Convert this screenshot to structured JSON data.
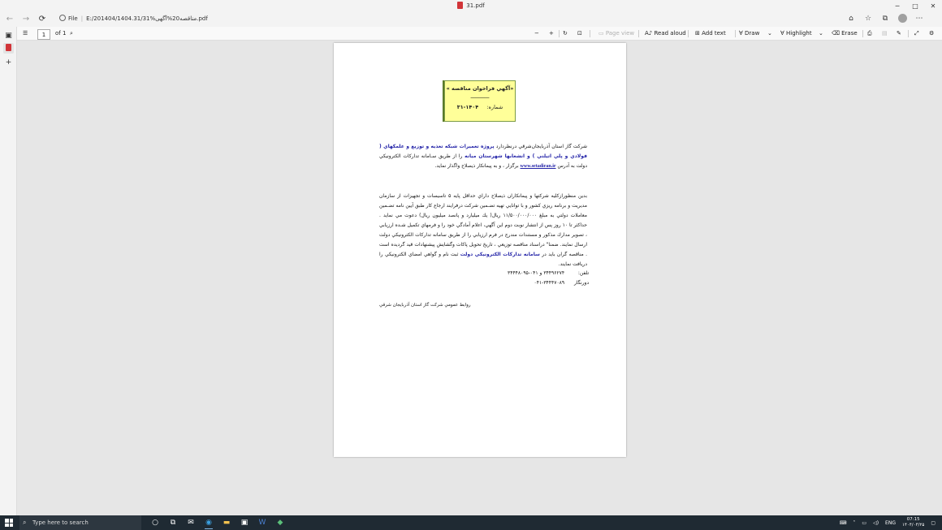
{
  "window": {
    "title": "31.pdf",
    "controls": {
      "minimize": "─",
      "maximize": "□",
      "close": "✕"
    }
  },
  "address_bar": {
    "file_label": "File",
    "path": "E:/201404/1404.31/31%مناقصه20%آگهی.pdf"
  },
  "pdf_toolbar": {
    "page_current": "1",
    "page_of": "of 1",
    "page_view_label": "Page view",
    "read_aloud_label": "Read aloud",
    "add_text_label": "Add text",
    "draw_label": "Draw",
    "highlight_label": "Highlight",
    "erase_label": "Erase"
  },
  "document": {
    "notice_title": "«آگهي فراخوان مناقصه »",
    "notice_dashes": "ـــــــــــــ",
    "notice_number_label": "شماره:",
    "notice_number": "۱۴۰۴-۳۱",
    "paragraph1": {
      "intro": "شركت گاز استان آذربايجان‌شرقي درنظردارد ",
      "project": "پروژه تعميرات شبكه تغذيه و توزيع و علمكهاي ( فولادي و پلي اتيلني ) و انشعابها شهرستان ميانه",
      "mid": " را از طريق سـامانه تداركات الكترونيكي دولت به آدرس ",
      "url": "www.setadiran.ir",
      "end": " برگزار ، و به پيمانكار ذيصلاح واگذار نمايد."
    },
    "paragraph2": {
      "text1": "بدين منظوراز‌كليه شركتها و پيمانكاران ذيصلاح داراي حداقل پايه ۵ تاسيسات و تجهيزات از سازمان مديريت و برنامه ريزي كشور و با توانايي تهيه تضـمين شركت درفرايند ارجاع كار طبق آيين نامه تضـمين معاملات دولتي به مبلغ ۱۱/۵۰۰/۰۰۰/۰۰۰ ريال( يك ميليارد و پانصد ميليون ريال) دعوت مي نمايد . حداكثر تا ۱۰ روز پس از انتشار نوبت دوم اين آگهي، اعلام آمادگي خود را و فرمهاي تكميل شـده ارزيابي ، تصوير مدارك مذكور و مستندات مندرج در فرم ارزيابي را از طريق سامانه تداركات الكترونيكي دولت ارسال نمايند. ضمنا\" درا‌سناد مناقصه توزيعي ، تاريخ تحويل پاكات وگشايش پيشنهادات قيد گرديده است . مناقصه گران بايد در ",
      "blue": "سامانه تداركات الكترونيكي دولت",
      "text2": " ثبت نام و گواهي امضاي الكترونيكي را دريافت نمايند."
    },
    "phone_label": "تلفن:",
    "phone_value": "۳۴۴۹۶۲۷۴ و ۰۴۱-۳۴۴۴۸۰۹۵",
    "fax_label": "دورنگار",
    "fax_value": "۰۴۱-۳۴۴۴۷۰۸۹",
    "footer": "روابط عمومي شركت گاز استان آذربايجان شرقي"
  },
  "taskbar": {
    "search_placeholder": "Type here to search",
    "language": "ENG",
    "time": "07:15",
    "date": "۱۴۰۴/۰۴/۲۵"
  },
  "colors": {
    "notice_bg": "#ffff99",
    "link_blue": "#2424a8",
    "pdf_red": "#d13438",
    "taskbar": "#1f2a33"
  }
}
